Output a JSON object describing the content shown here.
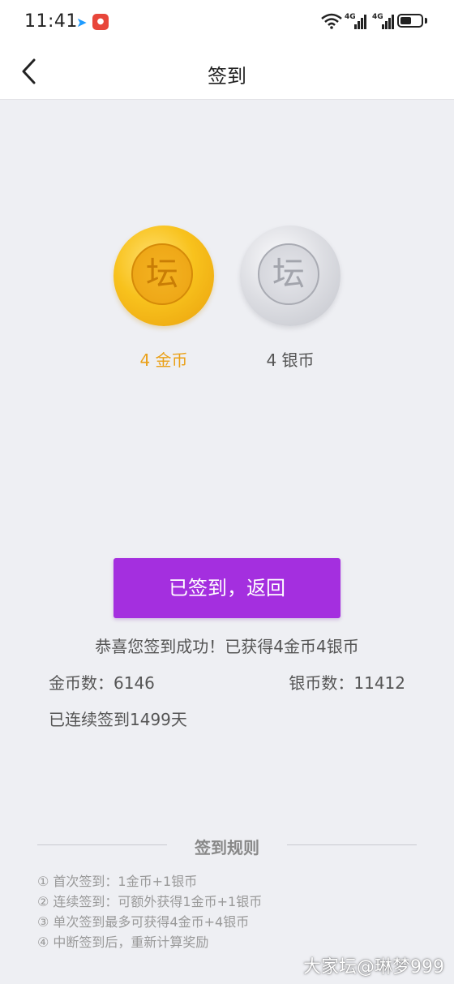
{
  "status_bar": {
    "time": "11:41",
    "network_1": "4G",
    "network_2": "4G",
    "battery_level": 0.45
  },
  "nav": {
    "title": "签到"
  },
  "coins": {
    "gold_label": "4 金币",
    "silver_label": "4 银币",
    "coin_glyph": "坛"
  },
  "action": {
    "button_label": "已签到，返回"
  },
  "result": {
    "success_message": "恭喜您签到成功！已获得4金币4银币",
    "gold_count": "金币数：6146",
    "silver_count": "银币数：11412",
    "streak": "已连续签到1499天"
  },
  "rules": {
    "title": "签到规则",
    "items": [
      "① 首次签到：1金币+1银币",
      "② 连续签到：可额外获得1金币+1银币",
      "③ 单次签到最多可获得4金币+4银币",
      "④ 中断签到后，重新计算奖励"
    ]
  },
  "watermark": "大家坛@琳梦999",
  "colors": {
    "accent_purple": "#a42fdf",
    "gold_text": "#eaa017",
    "background": "#eeeff3"
  }
}
